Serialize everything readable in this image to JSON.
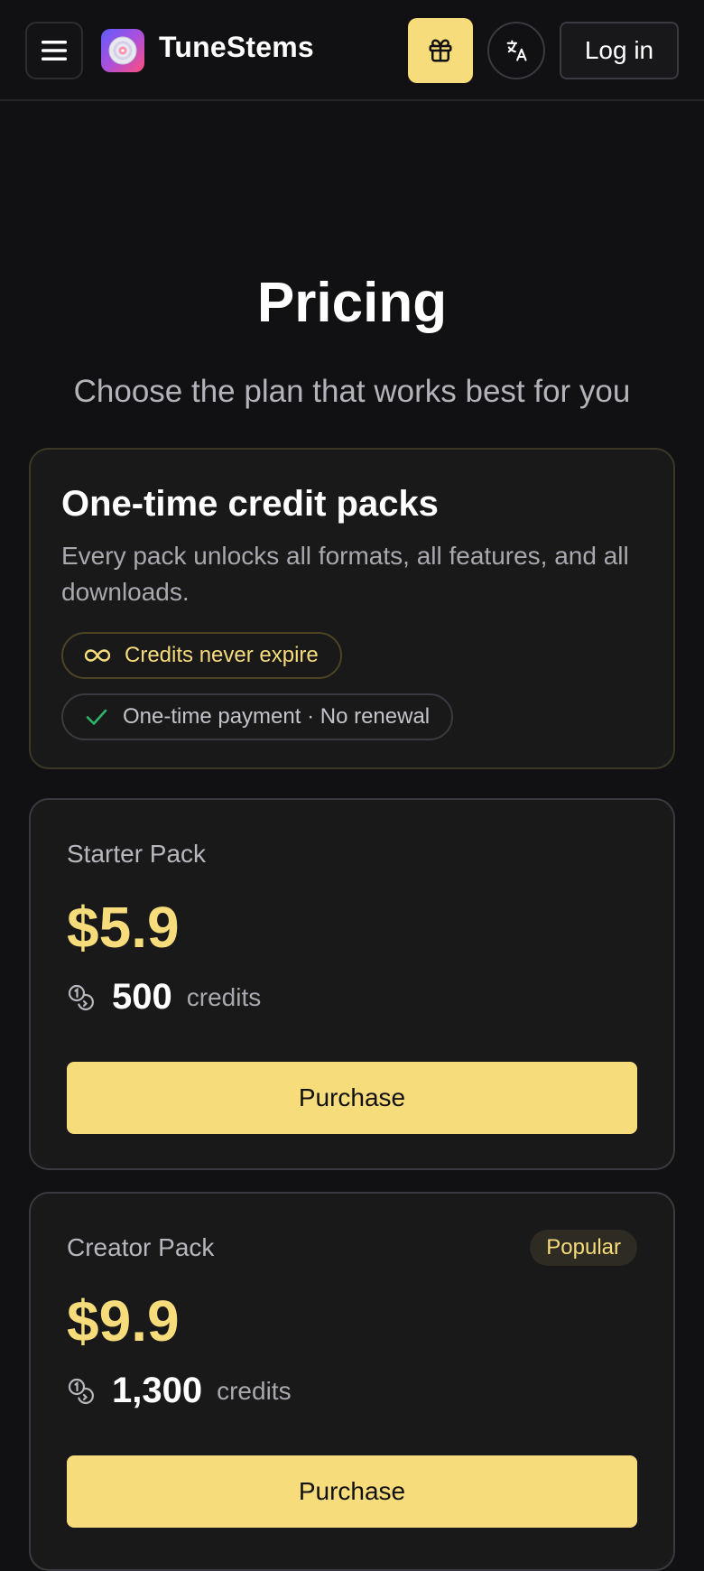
{
  "header": {
    "brand": "TuneStems",
    "login_label": "Log in"
  },
  "hero": {
    "title": "Pricing",
    "subtitle": "Choose the plan that works best for you"
  },
  "info": {
    "title": "One-time credit packs",
    "description": "Every pack unlocks all formats, all features, and all downloads.",
    "pills": [
      {
        "icon": "infinity-icon",
        "label": "Credits never expire"
      },
      {
        "icon": "checkmark-icon",
        "label": "One-time payment · No renewal"
      }
    ]
  },
  "packs": [
    {
      "name": "Starter Pack",
      "price": "$5.9",
      "credits": "500",
      "credits_label": "credits",
      "badge": "",
      "button": "Purchase"
    },
    {
      "name": "Creator Pack",
      "price": "$9.9",
      "credits": "1,300",
      "credits_label": "credits",
      "badge": "Popular",
      "button": "Purchase"
    }
  ],
  "colors": {
    "accent": "#f7dc7b",
    "background": "#111113",
    "card": "#19191a",
    "check_green": "#2fb56a"
  }
}
